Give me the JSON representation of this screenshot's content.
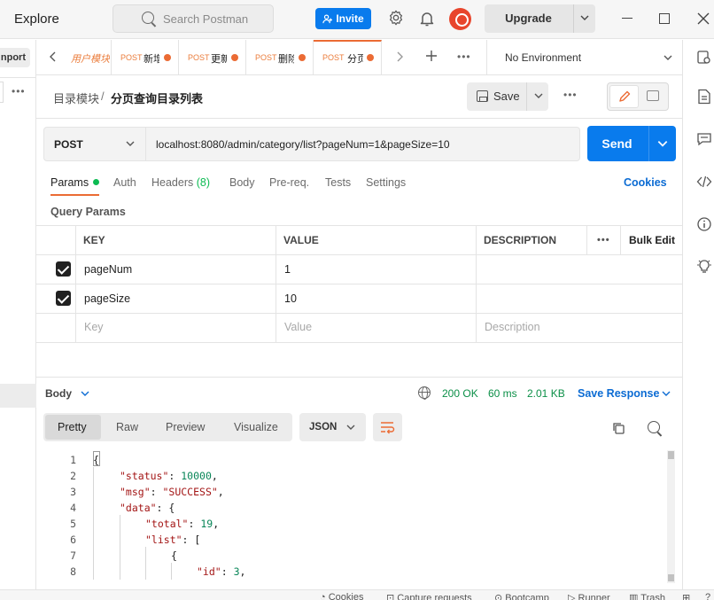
{
  "topbar": {
    "title": "Explore",
    "search_placeholder": "Search Postman",
    "invite_label": "Invite",
    "upgrade_label": "Upgrade"
  },
  "sidebar": {
    "import_label": "nport"
  },
  "tabs": [
    {
      "method": "",
      "name": "用户模块"
    },
    {
      "method": "POST",
      "name": "新增"
    },
    {
      "method": "POST",
      "name": "更新"
    },
    {
      "method": "POST",
      "name": "删除"
    },
    {
      "method": "POST",
      "name": "分页"
    }
  ],
  "environment": "No Environment",
  "request": {
    "breadcrumb_parent": "目录模块",
    "breadcrumb_sep": "/",
    "breadcrumb_current": "分页查询目录列表",
    "save_label": "Save",
    "method": "POST",
    "url": "localhost:8080/admin/category/list?pageNum=1&pageSize=10",
    "send_label": "Send"
  },
  "request_tabs": {
    "params": "Params",
    "auth": "Auth",
    "headers": "Headers",
    "headers_count": "(8)",
    "body": "Body",
    "prereq": "Pre-req.",
    "tests": "Tests",
    "settings": "Settings",
    "cookies": "Cookies"
  },
  "query_params": {
    "title": "Query Params",
    "headers": {
      "key": "KEY",
      "value": "VALUE",
      "description": "DESCRIPTION",
      "bulk_edit": "Bulk Edit"
    },
    "rows": [
      {
        "key": "pageNum",
        "value": "1",
        "checked": true
      },
      {
        "key": "pageSize",
        "value": "10",
        "checked": true
      }
    ],
    "placeholder": {
      "key": "Key",
      "value": "Value",
      "description": "Description"
    }
  },
  "response": {
    "body_label": "Body",
    "status": "200 OK",
    "time": "60 ms",
    "size": "2.01 KB",
    "save_label": "Save Response",
    "view_tabs": [
      "Pretty",
      "Raw",
      "Preview",
      "Visualize"
    ],
    "format": "JSON",
    "line_numbers": [
      "1",
      "2",
      "3",
      "4",
      "5",
      "6",
      "7",
      "8"
    ],
    "code": {
      "l1": "{",
      "status_key": "\"status\"",
      "status_val": "10000",
      "msg_key": "\"msg\"",
      "msg_val": "\"SUCCESS\"",
      "data_key": "\"data\"",
      "data_open": "{",
      "total_key": "\"total\"",
      "total_val": "19",
      "list_key": "\"list\"",
      "list_open": "[",
      "l7": "{",
      "id_key": "\"id\"",
      "id_val": "3"
    }
  },
  "statusbar": [
    "Cookies",
    "Capture requests",
    "Bootcamp",
    "Runner",
    "Trash"
  ]
}
